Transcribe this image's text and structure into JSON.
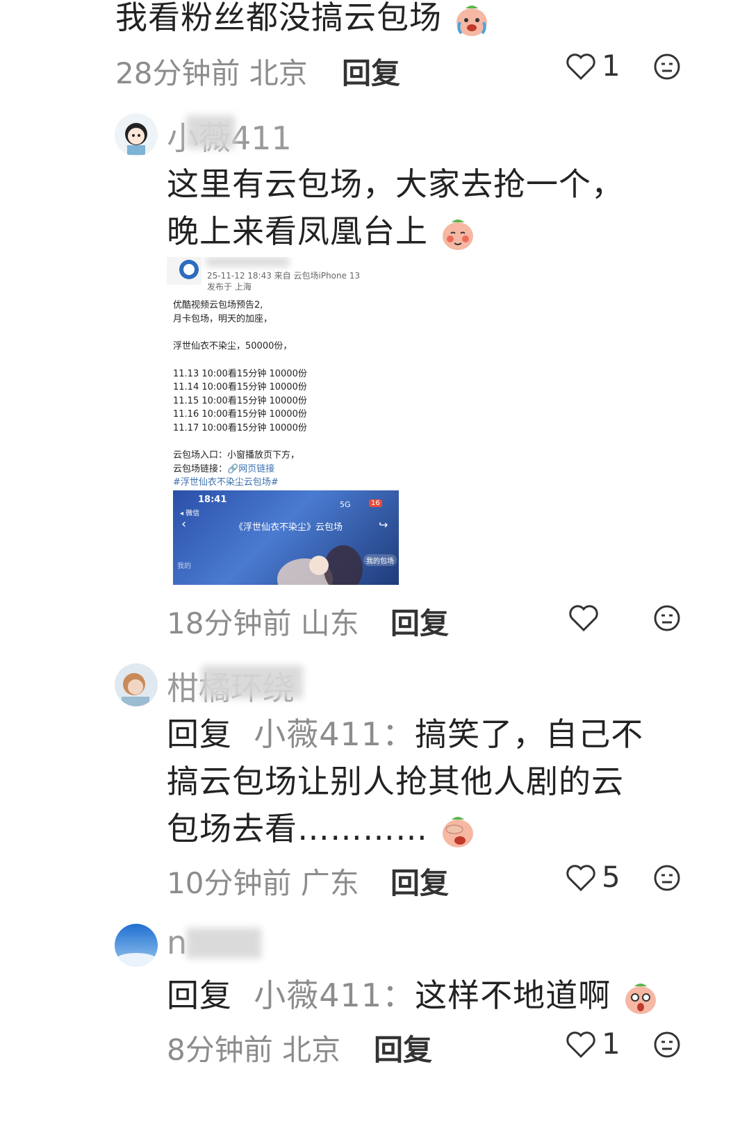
{
  "comment1": {
    "text": "我看粉丝都没搞云包场",
    "meta": "28分钟前 北京",
    "reply": "回复",
    "likes": "1"
  },
  "comment2": {
    "username": "小薇411",
    "line1": "这里有云包场，大家去抢一个，",
    "line2": "晚上来看凤凰台上",
    "meta": "18分钟前 山东",
    "reply": "回复",
    "screenshot": {
      "header": "25-11-12 18:43  来自 云包场iPhone 13",
      "location": "发布于 上海",
      "lines": [
        "优酷视频云包场预告2,",
        "月卡包场，明天的加座，",
        "浮世仙衣不染尘，50000份，",
        "11.13 10:00看15分钟 10000份",
        "11.14 10:00看15分钟 10000份",
        "11.15 10:00看15分钟 10000份",
        "11.16 10:00看15分钟 10000份",
        "11.17 10:00看15分钟 10000份",
        "云包场入口：小窗播放页下方，"
      ],
      "link_prefix": "云包场链接：",
      "link_text": "🔗网页链接",
      "hashtag": "#浮世仙衣不染尘云包场#",
      "phone": {
        "time": "18:41",
        "back_label": "◂ 微信",
        "signal": "5G",
        "battery": "16",
        "title": "《浮世仙衣不染尘》云包场",
        "left_tag": "我的",
        "right_tag": "我的包场"
      }
    }
  },
  "comment3": {
    "username": "柑橘环绕",
    "reply_prefix": "回复",
    "mention": "小薇411：",
    "line1_text": "搞笑了，自己不",
    "line2": "搞云包场让别人抢其他人剧的云",
    "line3": "包场去看…………",
    "meta": "10分钟前 广东",
    "reply": "回复",
    "likes": "5"
  },
  "comment4": {
    "username": "n",
    "reply_prefix": "回复",
    "mention": "小薇411：",
    "text": "这样不地道啊",
    "meta": "8分钟前 北京",
    "reply": "回复",
    "likes": "1"
  }
}
